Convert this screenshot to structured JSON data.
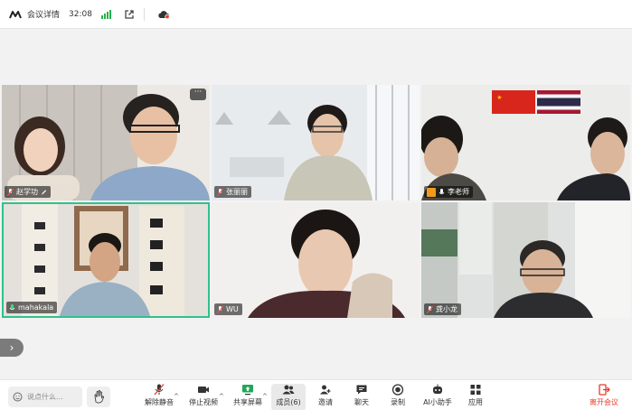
{
  "topbar": {
    "meeting_details": "会议详情",
    "timer": "32:08"
  },
  "participants": [
    {
      "name": "赵学功",
      "mic": "muted",
      "editing": true
    },
    {
      "name": "张丽丽",
      "mic": "muted"
    },
    {
      "name": "李老师",
      "mic": "on",
      "host": true
    },
    {
      "name": "mahakala",
      "mic": "active-speaker"
    },
    {
      "name": "WU",
      "mic": "muted"
    },
    {
      "name": "龚小龙",
      "mic": "muted"
    }
  ],
  "tile_more_label": "···",
  "side_toggle": "›",
  "chat": {
    "placeholder": "说点什么..."
  },
  "toolbar": {
    "unmute": "解除静音",
    "stop_video": "停止视频",
    "share_screen": "共享屏幕",
    "members": "成员(6)",
    "invite": "邀请",
    "chat": "聊天",
    "record": "录制",
    "ai_assistant": "AI小助手",
    "apps": "应用",
    "leave": "离开会议",
    "caret": "^"
  },
  "colors": {
    "accent": "#27b14a",
    "speaker_border": "#2fc28a",
    "leave_red": "#e53b2e",
    "host_badge": "#f39a1c"
  }
}
